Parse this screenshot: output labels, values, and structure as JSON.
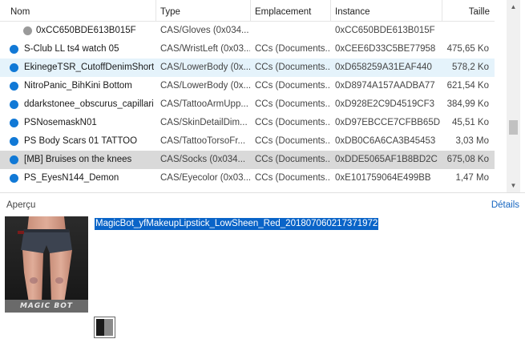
{
  "columns": {
    "nom": "Nom",
    "type": "Type",
    "emplacement": "Emplacement",
    "instance": "Instance",
    "taille": "Taille"
  },
  "rows": [
    {
      "nom": "0xCC650BDE613B015F",
      "type": "CAS/Gloves (0x034...",
      "emplacement": "",
      "instance": "0xCC650BDE613B015F",
      "taille": "",
      "status_color": "#9a9a9a"
    },
    {
      "nom": "S-Club LL ts4  watch 05",
      "type": "CAS/WristLeft (0x03...",
      "emplacement": "CCs (Documents...",
      "instance": "0xCEE6D33C5BE77958",
      "taille": "475,65 Ko",
      "status_color": "#1179d6"
    },
    {
      "nom": "EkinegeTSR_CutoffDenimShort...",
      "type": "CAS/LowerBody (0x...",
      "emplacement": "CCs (Documents...",
      "instance": "0xD658259A31EAF440",
      "taille": "578,2 Ko",
      "status_color": "#1179d6"
    },
    {
      "nom": "NitroPanic_BihKini Bottom",
      "type": "CAS/LowerBody (0x...",
      "emplacement": "CCs (Documents...",
      "instance": "0xD8974A157AADBA77",
      "taille": "621,54 Ko",
      "status_color": "#1179d6"
    },
    {
      "nom": "ddarkstonee_obscurus_capillaries",
      "type": "CAS/TattooArmUpp...",
      "emplacement": "CCs (Documents...",
      "instance": "0xD928E2C9D4519CF3",
      "taille": "384,99 Ko",
      "status_color": "#1179d6"
    },
    {
      "nom": "PSNosemaskN01",
      "type": "CAS/SkinDetailDim...",
      "emplacement": "CCs (Documents...",
      "instance": "0xD97EBCCE7CFBB65D",
      "taille": "45,51 Ko",
      "status_color": "#1179d6"
    },
    {
      "nom": "PS Body Scars 01 TATTOO",
      "type": "CAS/TattooTorsoFr...",
      "emplacement": "CCs (Documents...",
      "instance": "0xDB0C6A6CA3B45453",
      "taille": "3,03 Mo",
      "status_color": "#1179d6"
    },
    {
      "nom": "[MB] Bruises on the knees",
      "type": "CAS/Socks (0x034...",
      "emplacement": "CCs (Documents...",
      "instance": "0xDDE5065AF1B8BD2C",
      "taille": "675,08 Ko",
      "status_color": "#1179d6"
    },
    {
      "nom": "PS_EyesN144_Demon",
      "type": "CAS/Eyecolor (0x03...",
      "emplacement": "CCs (Documents...",
      "instance": "0xE101759064E499BB",
      "taille": "1,47 Mo",
      "status_color": "#1179d6"
    }
  ],
  "preview": {
    "label": "Aperçu",
    "details_link": "Détails",
    "filename": "MagicBot_yfMakeupLipstick_LowSheen_Red_201807060217371972",
    "thumbnail_watermark": "MAGIC BOT"
  },
  "icons": {
    "scroll_up": "chevron-up-icon",
    "scroll_down": "chevron-down-icon"
  }
}
